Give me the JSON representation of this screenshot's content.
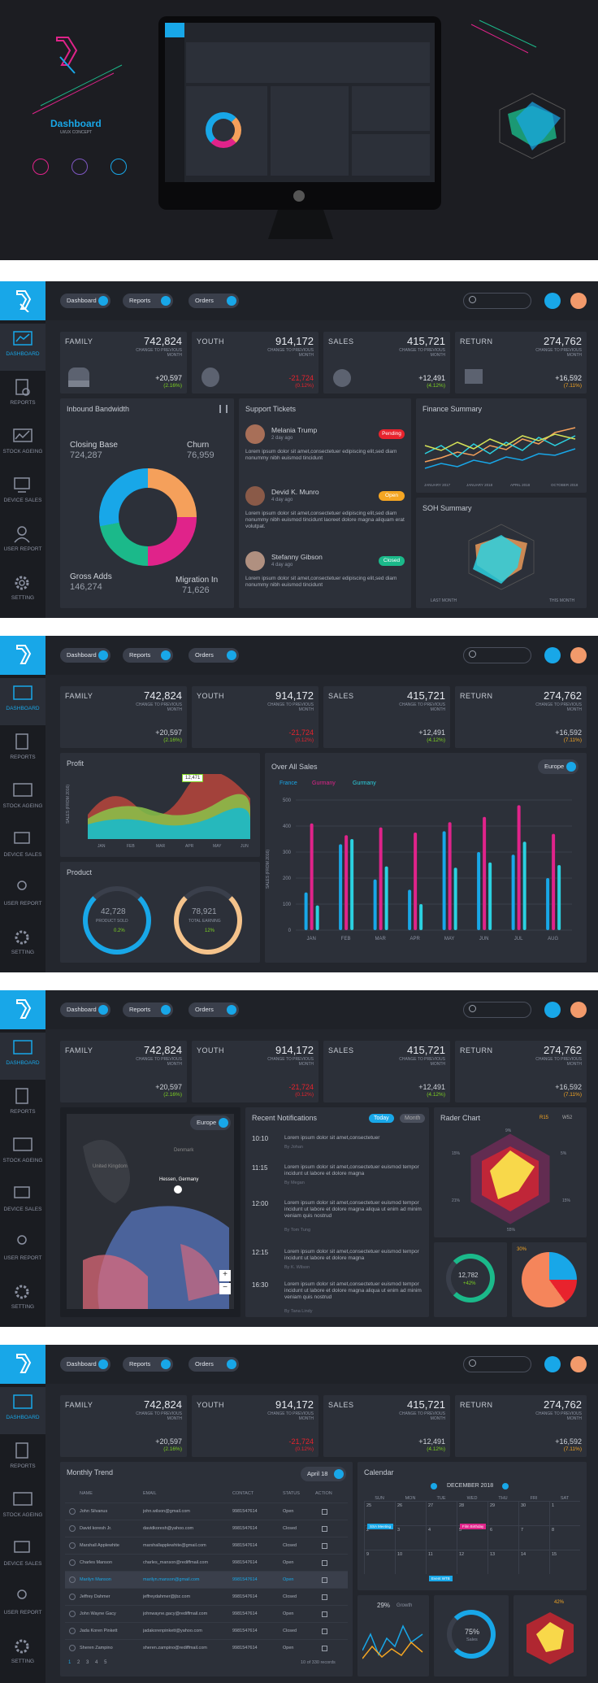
{
  "hero": {
    "title": "Dashboard",
    "subtitle": "UI/UX CONCEPT"
  },
  "nav": {
    "dashboard": "DASHBOARD",
    "reports": "REPORTS",
    "stock_ageing": "STOCK AGEING",
    "device_sales": "DEVICE SALES",
    "user_report": "USER REPORT",
    "setting": "SETTING"
  },
  "topbar": {
    "dashboard": "Dashboard",
    "reports": "Reports",
    "orders": "Orders"
  },
  "stats": {
    "change_label": "CHANGE TO PREVIOUS MONTH",
    "family": {
      "title": "FAMILY",
      "value": "742,824",
      "change": "+20,597",
      "pct": "(2.16%)"
    },
    "youth": {
      "title": "YOUTH",
      "value": "914,172",
      "change": "-21,724",
      "pct": "(0.12%)"
    },
    "sales": {
      "title": "SALES",
      "value": "415,721",
      "change": "+12,491",
      "pct": "(4.12%)"
    },
    "ret": {
      "title": "RETURN",
      "value": "274,762",
      "change": "+16,592",
      "pct": "(7.11%)"
    }
  },
  "colors": {
    "accent": "#18a7e8",
    "green": "#7ed321",
    "red": "#e8232d",
    "orange": "#f5a623"
  },
  "p1": {
    "bandwidth_title": "Inbound Bandwidth",
    "closing_base": "Closing Base",
    "closing_val": "724,287",
    "churn": "Churn",
    "churn_val": "76,959",
    "gross_adds": "Gross Adds",
    "gross_val": "146,274",
    "migration": "Migration In",
    "migration_val": "71,626",
    "tickets_title": "Support Tickets",
    "tickets": [
      {
        "name": "Melania Trump",
        "time": "2 day ago",
        "status": "Pending",
        "text": "Lorem ipsum dolor sit amet,consectetuer edipiscing elit,sed diam nonummy nibh euismod tincidunt"
      },
      {
        "name": "Devid K. Munro",
        "time": "4 day ago",
        "status": "Open",
        "text": "Lorem ipsum dolor sit amet,consectetuer edipiscing elit,sed diam nonummy nibh euismod tincidunt laoreet dolore magna aliquam erat volutpat."
      },
      {
        "name": "Stefanny Gibson",
        "time": "4 day ago",
        "status": "Closed",
        "text": "Lorem ipsum dolor sit amet,consectetuer edipiscing elit,sed diam nonummy nibh euismod tincidunt"
      }
    ],
    "finance_title": "Finance Summary",
    "finance_x": [
      "JANUARY 2017",
      "JANUARY 2018",
      "APRIL 2018",
      "OCTOBER 2018"
    ],
    "soh_title": "SOH Summary",
    "soh_legend1": "LAST MONTH",
    "soh_legend2": "THIS MONTH"
  },
  "p2": {
    "profit_title": "Profit",
    "profit_ylabel": "SALES (FROM 2016)",
    "profit_tooltip": "12,471",
    "profit_x": [
      "JAN",
      "FEB",
      "MAR",
      "APR",
      "MAY",
      "JUN"
    ],
    "product_title": "Product",
    "product_sold_val": "42,728",
    "product_sold_label": "PRODUCT SOLD",
    "product_sold_pct": "0.2%",
    "earning_val": "78,921",
    "earning_label": "TOTAL EARNING",
    "earning_pct": "12%",
    "sales_title": "Over All Sales",
    "region": "Europe",
    "legend": [
      "France",
      "Gurmany",
      "Gurmany"
    ],
    "ylabel": "SALES (FROM 2016)"
  },
  "chart_data": {
    "type": "bar",
    "categories": [
      "JAN",
      "FEB",
      "MAR",
      "APR",
      "MAY",
      "JUN",
      "JUL",
      "AUG"
    ],
    "ylim": [
      0,
      500
    ],
    "yticks": [
      0,
      100,
      200,
      300,
      400,
      500
    ],
    "series": [
      {
        "name": "France",
        "values": [
          145,
          330,
          195,
          155,
          380,
          300,
          290,
          200
        ]
      },
      {
        "name": "Gurmany",
        "values": [
          410,
          365,
          395,
          375,
          415,
          435,
          480,
          370
        ]
      },
      {
        "name": "Gurmany",
        "values": [
          95,
          350,
          245,
          100,
          240,
          260,
          340,
          250
        ]
      }
    ],
    "colors": [
      "#18a7e8",
      "#e0238a",
      "#2bd1e0"
    ]
  },
  "p3": {
    "map_region": "Europe",
    "map_marker": "Hessen, Germany",
    "map_labels": {
      "denmark": "Denmark",
      "uk": "United Kingdom"
    },
    "notif_title": "Recent Notifications",
    "today": "Today",
    "month": "Month",
    "notifs": [
      {
        "time": "10:10",
        "text": "Lorem ipsum dolor sit amet,consectetuer",
        "by": "By Johan"
      },
      {
        "time": "11:15",
        "text": "Lorem ipsum dolor sit amet,consectetuer euismod tempor incidunt ut labore et dolore magna",
        "by": "By Megan"
      },
      {
        "time": "12:00",
        "text": "Lorem ipsum dolor sit amet,consectetuer euismod tempor incidunt ut labore et dolore magna aliqua ut enim ad minim veniam quis nostrud",
        "by": "By Tom Tung"
      },
      {
        "time": "12:15",
        "text": "Lorem ipsum dolor sit amet,consectetuer euismod tempor incidunt ut labore et dolore magna",
        "by": "By K. Wilson"
      },
      {
        "time": "16:30",
        "text": "Lorem ipsum dolor sit amet,consectetuer euismod tempor incidunt ut labore et dolore magna aliqua ut enim ad minim veniam quis nostrud",
        "by": "By Tana Lindy"
      }
    ],
    "radar_title": "Rader Chart",
    "radar_l1": "R15",
    "radar_l2": "W52",
    "radar_ticks": [
      "9%",
      "5%",
      "15%",
      "55%",
      "21%",
      "15%"
    ],
    "ring_val": "12,782",
    "ring_pct": "+42%",
    "pie_pct": "30%"
  },
  "p4": {
    "trend_title": "Monthly Trend",
    "trend_filter": "April 18",
    "columns": [
      "NAME",
      "EMAIL",
      "CONTACT",
      "STATUS",
      "ACTION"
    ],
    "rows": [
      [
        "John Silvanus",
        "john.wilson@gmail.com",
        "9981547614",
        "Open"
      ],
      [
        "David koresh Jr.",
        "davidkoresh@yahoo.com",
        "9981547614",
        "Closed"
      ],
      [
        "Marshall Applewhite",
        "marshallapplewhite@gmail.com",
        "9981547614",
        "Closed"
      ],
      [
        "Charles Manson",
        "charles_manson@rediffmail.com",
        "9981547614",
        "Open"
      ],
      [
        "Marilyn Manson",
        "marilyn.manson@gmail.com",
        "9981547614",
        "Open"
      ],
      [
        "Jeffrey Dahmer",
        "jeffreydahmer@jbz.com",
        "9981547614",
        "Closed"
      ],
      [
        "John Wayne Gacy",
        "johnwayne.gacy@rediffmail.com",
        "9981547614",
        "Open"
      ],
      [
        "Jada Koren Pinkett",
        "jadakorenpinkett@yahoo.com",
        "9981547614",
        "Closed"
      ],
      [
        "Sheren Zampino",
        "sheren.zampino@rediffmail.com",
        "9981547614",
        "Open"
      ]
    ],
    "pagination": [
      "1",
      "2",
      "3",
      "4",
      "5"
    ],
    "records": "10 of 330 records",
    "cal_title": "Calendar",
    "cal_month": "DECEMBER 2018",
    "days": [
      "SUN",
      "MON",
      "TUE",
      "WED",
      "THU",
      "FRI",
      "SAT"
    ],
    "events": [
      "SSA Meeting",
      "Film Birthday",
      "Event WTB"
    ],
    "growth_pct": "29%",
    "growth_label": "Growth",
    "sales_pct": "75%",
    "sales_label": "Sales",
    "radar_pct": "42%"
  }
}
